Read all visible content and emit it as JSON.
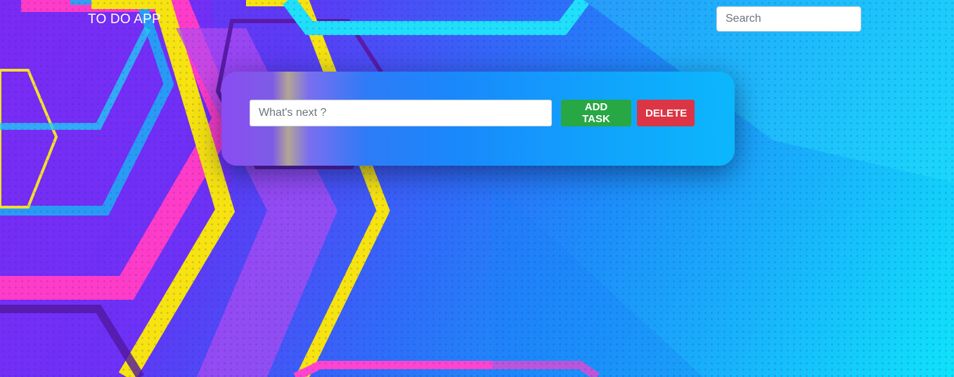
{
  "navbar": {
    "brand": "TO DO APP",
    "search_placeholder": "Search"
  },
  "task_form": {
    "input_placeholder": "What's next ?",
    "add_label": "ADD TASK",
    "delete_label": "DELETE"
  },
  "colors": {
    "add_button": "#28a745",
    "delete_button": "#dc3545",
    "background_start": "#7a2cf0",
    "background_end": "#0fe3fa"
  }
}
